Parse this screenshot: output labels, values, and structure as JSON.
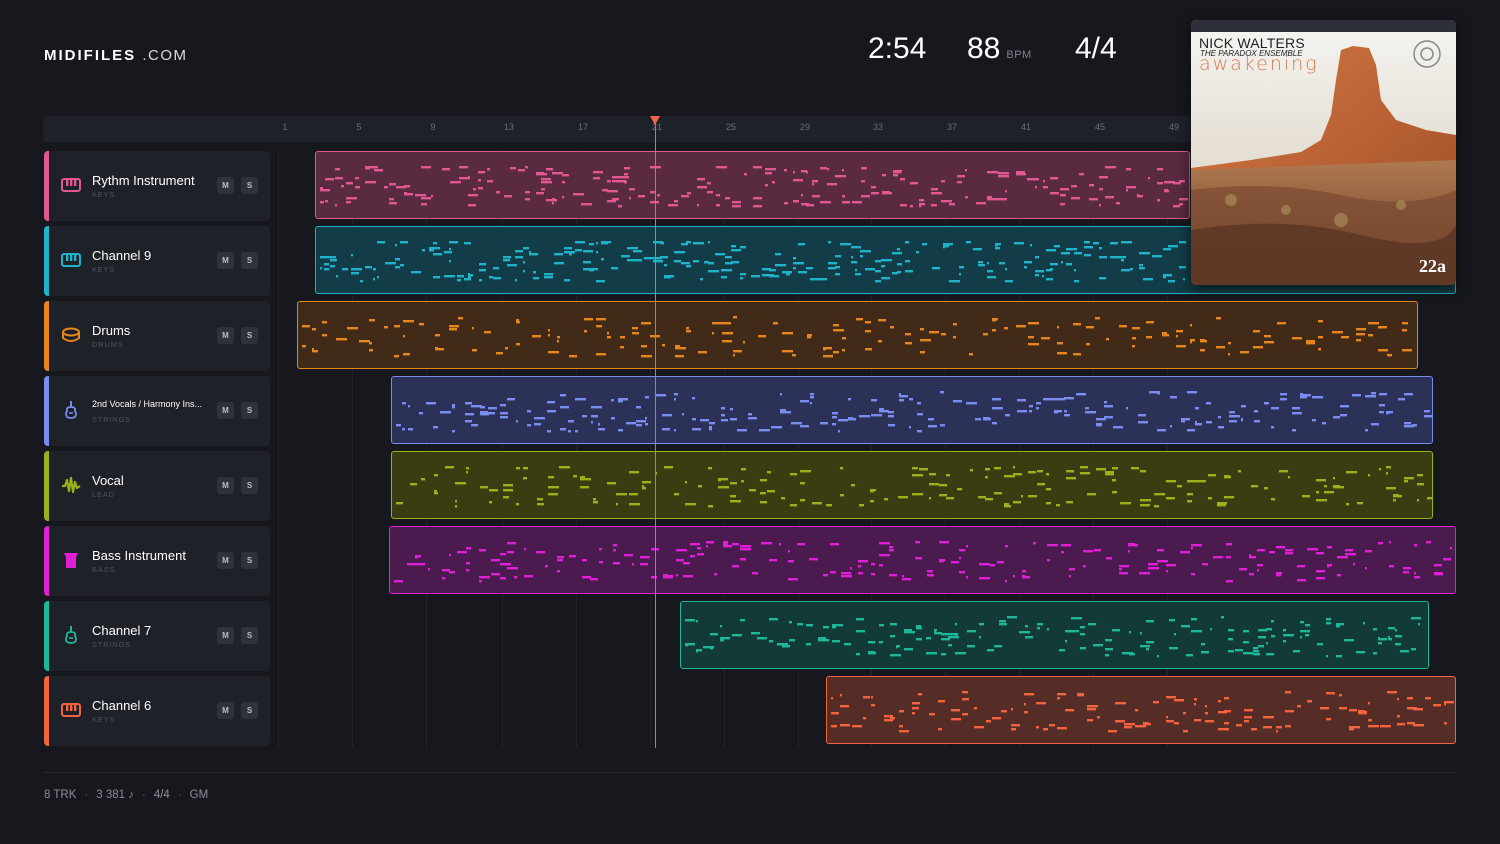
{
  "brand": {
    "name": "MIDIFILES",
    "suffix": ".COM"
  },
  "stats": {
    "time": "2:54",
    "bpm": "88",
    "bpm_unit": "BPM",
    "signature": "4/4"
  },
  "ruler": {
    "ticks": [
      "1",
      "5",
      "9",
      "13",
      "17",
      "21",
      "25",
      "29",
      "33",
      "37",
      "41",
      "45",
      "49"
    ]
  },
  "tracks": [
    {
      "name": "Rythm Instrument",
      "category": "KEYS",
      "color": "#e0588f",
      "icon": "piano-icon",
      "mute": "M",
      "solo": "S"
    },
    {
      "name": "Channel 9",
      "category": "KEYS",
      "color": "#1fb2c9",
      "icon": "piano-icon",
      "mute": "M",
      "solo": "S"
    },
    {
      "name": "Drums",
      "category": "DRUMS",
      "color": "#e7861d",
      "icon": "drum-icon",
      "mute": "M",
      "solo": "S"
    },
    {
      "name": "2nd Vocals / Harmony Ins...",
      "category": "STRINGS",
      "color": "#7b8cf0",
      "icon": "violin-icon",
      "mute": "M",
      "solo": "S"
    },
    {
      "name": "Vocal",
      "category": "LEAD",
      "color": "#9cb01b",
      "icon": "waveform-icon",
      "mute": "M",
      "solo": "S"
    },
    {
      "name": "Bass Instrument",
      "category": "BASS",
      "color": "#e01fd7",
      "icon": "bass-icon",
      "mute": "M",
      "solo": "S"
    },
    {
      "name": "Channel 7",
      "category": "STRINGS",
      "color": "#1fb79a",
      "icon": "violin-icon",
      "mute": "M",
      "solo": "S"
    },
    {
      "name": "Channel 6",
      "category": "KEYS",
      "color": "#f2633e",
      "icon": "piano-icon",
      "mute": "M",
      "solo": "S"
    }
  ],
  "album": {
    "artist": "NICK WALTERS",
    "ensemble": "THE PARADOX ENSEMBLE",
    "title": "awakening",
    "number": "22a"
  },
  "footer": {
    "tracks": "8 TRK",
    "notes": "3 381 ♪",
    "signature": "4/4",
    "standard": "GM"
  }
}
